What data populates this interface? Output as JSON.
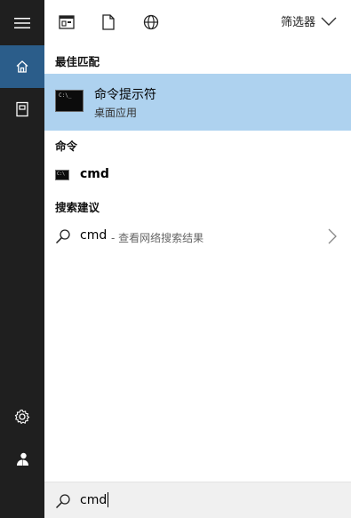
{
  "rail": {
    "items": [
      {
        "name": "menu",
        "icon": "hamburger-icon"
      },
      {
        "name": "home",
        "icon": "home-icon",
        "active": true
      },
      {
        "name": "documents",
        "icon": "documents-icon"
      },
      {
        "name": "settings",
        "icon": "gear-icon"
      },
      {
        "name": "user",
        "icon": "user-icon"
      }
    ],
    "colors": {
      "background": "#1f1f1f",
      "active": "#2b5d8a"
    }
  },
  "toolbar": {
    "icons": [
      "apps-filter-icon",
      "document-filter-icon",
      "web-filter-icon"
    ],
    "filter_label": "筛选器"
  },
  "sections": {
    "best_match": {
      "header": "最佳匹配",
      "title": "命令提示符",
      "subtitle": "桌面应用",
      "highlight_color": "#aed2ef"
    },
    "commands": {
      "header": "命令",
      "item_label": "cmd"
    },
    "web": {
      "header": "搜索建议",
      "query": "cmd",
      "suffix": " - 查看网络搜索结果"
    }
  },
  "searchbox": {
    "value": "cmd"
  }
}
